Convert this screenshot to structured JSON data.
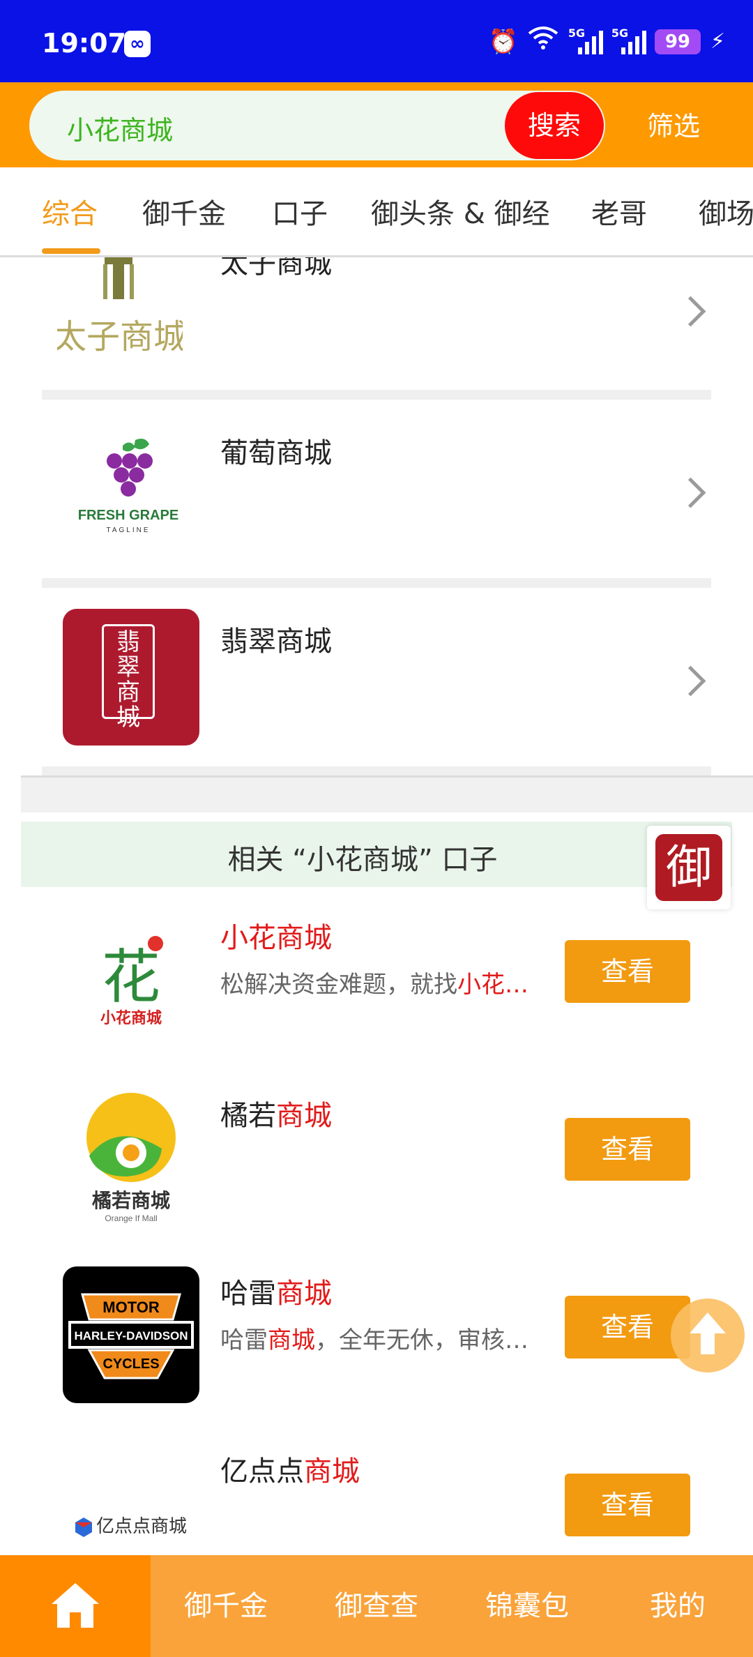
{
  "status_bar": {
    "time": "19:07",
    "signal1_label": "5G",
    "signal2_label": "5G",
    "battery": "99"
  },
  "search": {
    "query": "小花商城",
    "search_label": "搜索",
    "filter_label": "筛选"
  },
  "tabs": [
    {
      "label": "综合",
      "active": true
    },
    {
      "label": "御千金"
    },
    {
      "label": "口子"
    },
    {
      "label": "御头条 & 御经"
    },
    {
      "label": "老哥"
    },
    {
      "label": "御场"
    }
  ],
  "malls": [
    {
      "name": "太子商城",
      "logo_text": "太子商城"
    },
    {
      "name": "葡萄商城",
      "logo_text": "FRESH GRAPE",
      "logo_sub": "TAGLINE"
    },
    {
      "name": "翡翠商城",
      "logo_text": "翡翠商城"
    }
  ],
  "related_title": "相关 “小花商城” 口子",
  "float_badge": "御",
  "results": [
    {
      "title_plain": "",
      "title_red": "小花商城",
      "desc_plain": "松解决资金难题，就找",
      "desc_red": "小花…",
      "desc_after": "",
      "button": "查看",
      "logo_text": "花",
      "logo_sub": "小花商城"
    },
    {
      "title_plain": "橘若",
      "title_red": "商城",
      "desc_plain": "",
      "desc_red": "",
      "desc_after": "",
      "button": "查看",
      "logo_text": "橘若商城",
      "logo_sub": "Orange If Mall"
    },
    {
      "title_plain": "哈雷",
      "title_red": "商城",
      "desc_plain": "哈雷",
      "desc_red": "商城",
      "desc_after": "，全年无休，审核…",
      "button": "查看",
      "logo_text": "HARLEY-DAVIDSON",
      "logo_top": "MOTOR",
      "logo_bottom": "CYCLES"
    },
    {
      "title_plain": "亿点点",
      "title_red": "商城",
      "desc_plain": "",
      "desc_red": "",
      "desc_after": "",
      "button": "查看",
      "logo_text": "亿点点商城"
    }
  ],
  "bottom_nav": [
    {
      "label": "首页",
      "icon": "home-icon"
    },
    {
      "label": "御千金"
    },
    {
      "label": "御查查"
    },
    {
      "label": "锦囊包"
    },
    {
      "label": "我的"
    }
  ],
  "colors": {
    "status_bg": "#0a12e6",
    "accent_orange": "#ff9900",
    "search_red": "#ff0a0a",
    "highlight_red": "#e21a1a",
    "button_orange": "#f29a10"
  }
}
